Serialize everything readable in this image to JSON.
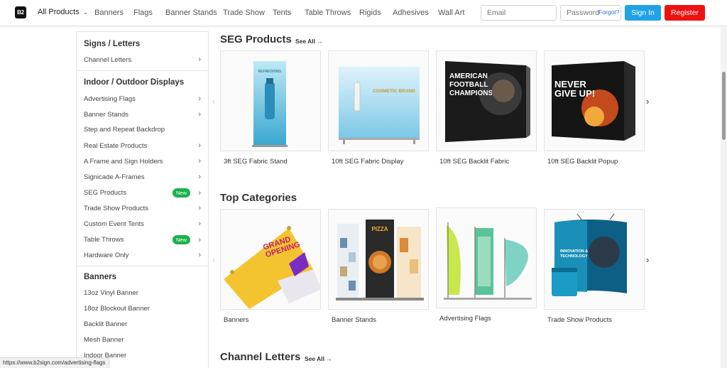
{
  "nav": {
    "logo": "B2",
    "all_products": "All Products",
    "links": [
      "Banners",
      "Flags",
      "Banner Stands",
      "Trade Show",
      "Tents",
      "Table Throws",
      "Rigids",
      "Adhesives",
      "Wall Art"
    ],
    "email_placeholder": "Email",
    "password_placeholder": "Password",
    "forgot": "Forgot?",
    "signin": "Sign In",
    "register": "Register"
  },
  "sidebar": {
    "sections": [
      {
        "heading": "Signs / Letters",
        "items": [
          {
            "label": "Channel Letters",
            "arrow": true,
            "badge": ""
          }
        ]
      },
      {
        "heading": "Indoor / Outdoor Displays",
        "items": [
          {
            "label": "Advertising Flags",
            "arrow": true,
            "badge": ""
          },
          {
            "label": "Banner Stands",
            "arrow": true,
            "badge": ""
          },
          {
            "label": "Step and Repeat Backdrop",
            "arrow": false,
            "badge": ""
          },
          {
            "label": "Real Estate Products",
            "arrow": true,
            "badge": ""
          },
          {
            "label": "A Frame and Sign Holders",
            "arrow": true,
            "badge": ""
          },
          {
            "label": "Signicade A-Frames",
            "arrow": true,
            "badge": ""
          },
          {
            "label": "SEG Products",
            "arrow": true,
            "badge": "New"
          },
          {
            "label": "Trade Show Products",
            "arrow": true,
            "badge": ""
          },
          {
            "label": "Custom Event Tents",
            "arrow": true,
            "badge": ""
          },
          {
            "label": "Table Throws",
            "arrow": true,
            "badge": "New"
          },
          {
            "label": "Hardware Only",
            "arrow": true,
            "badge": ""
          }
        ]
      },
      {
        "heading": "Banners",
        "items": [
          {
            "label": "13oz Vinyl Banner",
            "arrow": false,
            "badge": ""
          },
          {
            "label": "18oz Blockout Banner",
            "arrow": false,
            "badge": ""
          },
          {
            "label": "Backlit Banner",
            "arrow": false,
            "badge": ""
          },
          {
            "label": "Mesh Banner",
            "arrow": false,
            "badge": ""
          },
          {
            "label": "Indoor Banner",
            "arrow": false,
            "badge": ""
          }
        ]
      }
    ]
  },
  "main": {
    "seg": {
      "title": "SEG Products",
      "see_all": "See All →",
      "cards": [
        {
          "label": "3ft SEG Fabric Stand",
          "art_text": "REFRESHING"
        },
        {
          "label": "10ft SEG Fabric Display",
          "art_text": "COSMETIC BRAND"
        },
        {
          "label": "10ft SEG Backlit Fabric",
          "art_text": "AMERICAN FOOTBALL CHAMPIONSHIP"
        },
        {
          "label": "10ft SEG Backlit Popup",
          "art_text": "NEVER GIVE UP!"
        }
      ]
    },
    "top": {
      "title": "Top Categories",
      "cards": [
        {
          "label": "Banners",
          "art_text": "GRAND OPENING"
        },
        {
          "label": "Banner Stands",
          "art_text": "PIZZA"
        },
        {
          "label": "Advertising Flags",
          "art_text": ""
        },
        {
          "label": "Trade Show Products",
          "art_text": "INNOVATION & TECHNOLOGY"
        }
      ]
    },
    "channel": {
      "title": "Channel Letters",
      "see_all": "See All →"
    }
  },
  "status_url": "https://www.b2sign.com/advertising-flags",
  "colors": {
    "signin": "#1fa2e6",
    "register": "#ee1111",
    "badge": "#19b24b"
  }
}
